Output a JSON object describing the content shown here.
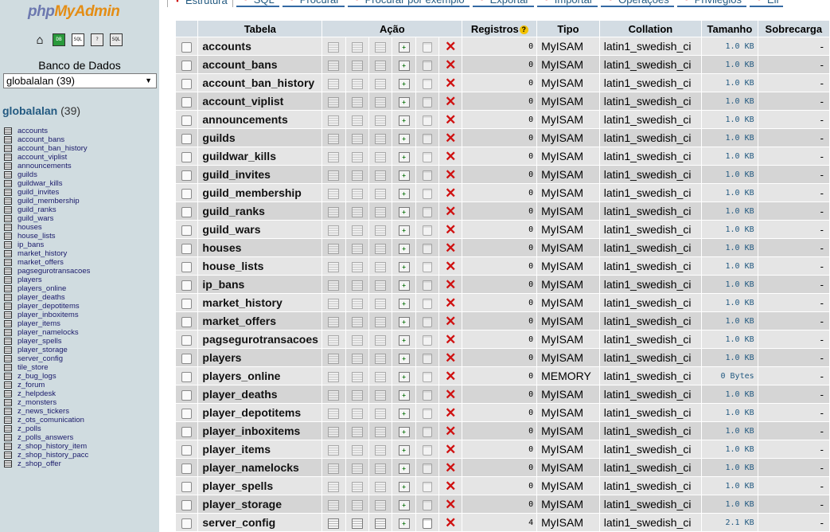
{
  "logo": {
    "part1": "php",
    "part2": "MyAdmin"
  },
  "nav_icons": [
    "home-icon",
    "db-icon",
    "sql-icon",
    "docs-icon",
    "query-icon"
  ],
  "left": {
    "db_label": "Banco de Dados",
    "db_select": "globalalan (39)",
    "db_name": "globalalan",
    "db_count": "(39)",
    "tables": [
      "accounts",
      "account_bans",
      "account_ban_history",
      "account_viplist",
      "announcements",
      "guilds",
      "guildwar_kills",
      "guild_invites",
      "guild_membership",
      "guild_ranks",
      "guild_wars",
      "houses",
      "house_lists",
      "ip_bans",
      "market_history",
      "market_offers",
      "pagsegurotransacoes",
      "players",
      "players_online",
      "player_deaths",
      "player_depotitems",
      "player_inboxitems",
      "player_items",
      "player_namelocks",
      "player_spells",
      "player_storage",
      "server_config",
      "tile_store",
      "z_bug_logs",
      "z_forum",
      "z_helpdesk",
      "z_monsters",
      "z_news_tickers",
      "z_ots_comunication",
      "z_polls",
      "z_polls_answers",
      "z_shop_history_item",
      "z_shop_history_pacc",
      "z_shop_offer"
    ]
  },
  "tabs": [
    "Estrutura",
    "SQL",
    "Procurar",
    "Procurar por exemplo",
    "Exportar",
    "Importar",
    "Operações",
    "Privilégios",
    "Eli"
  ],
  "headers": {
    "tabela": "Tabela",
    "acao": "Ação",
    "registros": "Registros",
    "tipo": "Tipo",
    "collation": "Collation",
    "tamanho": "Tamanho",
    "sobrecarga": "Sobrecarga"
  },
  "rows": [
    {
      "name": "accounts",
      "reg": "0",
      "tipo": "MyISAM",
      "col": "latin1_swedish_ci",
      "tam": "1.0 KB",
      "sob": "-"
    },
    {
      "name": "account_bans",
      "reg": "0",
      "tipo": "MyISAM",
      "col": "latin1_swedish_ci",
      "tam": "1.0 KB",
      "sob": "-"
    },
    {
      "name": "account_ban_history",
      "reg": "0",
      "tipo": "MyISAM",
      "col": "latin1_swedish_ci",
      "tam": "1.0 KB",
      "sob": "-"
    },
    {
      "name": "account_viplist",
      "reg": "0",
      "tipo": "MyISAM",
      "col": "latin1_swedish_ci",
      "tam": "1.0 KB",
      "sob": "-"
    },
    {
      "name": "announcements",
      "reg": "0",
      "tipo": "MyISAM",
      "col": "latin1_swedish_ci",
      "tam": "1.0 KB",
      "sob": "-"
    },
    {
      "name": "guilds",
      "reg": "0",
      "tipo": "MyISAM",
      "col": "latin1_swedish_ci",
      "tam": "1.0 KB",
      "sob": "-"
    },
    {
      "name": "guildwar_kills",
      "reg": "0",
      "tipo": "MyISAM",
      "col": "latin1_swedish_ci",
      "tam": "1.0 KB",
      "sob": "-"
    },
    {
      "name": "guild_invites",
      "reg": "0",
      "tipo": "MyISAM",
      "col": "latin1_swedish_ci",
      "tam": "1.0 KB",
      "sob": "-"
    },
    {
      "name": "guild_membership",
      "reg": "0",
      "tipo": "MyISAM",
      "col": "latin1_swedish_ci",
      "tam": "1.0 KB",
      "sob": "-"
    },
    {
      "name": "guild_ranks",
      "reg": "0",
      "tipo": "MyISAM",
      "col": "latin1_swedish_ci",
      "tam": "1.0 KB",
      "sob": "-"
    },
    {
      "name": "guild_wars",
      "reg": "0",
      "tipo": "MyISAM",
      "col": "latin1_swedish_ci",
      "tam": "1.0 KB",
      "sob": "-"
    },
    {
      "name": "houses",
      "reg": "0",
      "tipo": "MyISAM",
      "col": "latin1_swedish_ci",
      "tam": "1.0 KB",
      "sob": "-"
    },
    {
      "name": "house_lists",
      "reg": "0",
      "tipo": "MyISAM",
      "col": "latin1_swedish_ci",
      "tam": "1.0 KB",
      "sob": "-"
    },
    {
      "name": "ip_bans",
      "reg": "0",
      "tipo": "MyISAM",
      "col": "latin1_swedish_ci",
      "tam": "1.0 KB",
      "sob": "-"
    },
    {
      "name": "market_history",
      "reg": "0",
      "tipo": "MyISAM",
      "col": "latin1_swedish_ci",
      "tam": "1.0 KB",
      "sob": "-"
    },
    {
      "name": "market_offers",
      "reg": "0",
      "tipo": "MyISAM",
      "col": "latin1_swedish_ci",
      "tam": "1.0 KB",
      "sob": "-"
    },
    {
      "name": "pagsegurotransacoes",
      "reg": "0",
      "tipo": "MyISAM",
      "col": "latin1_swedish_ci",
      "tam": "1.0 KB",
      "sob": "-"
    },
    {
      "name": "players",
      "reg": "0",
      "tipo": "MyISAM",
      "col": "latin1_swedish_ci",
      "tam": "1.0 KB",
      "sob": "-"
    },
    {
      "name": "players_online",
      "reg": "0",
      "tipo": "MEMORY",
      "col": "latin1_swedish_ci",
      "tam": "0 Bytes",
      "sob": "-"
    },
    {
      "name": "player_deaths",
      "reg": "0",
      "tipo": "MyISAM",
      "col": "latin1_swedish_ci",
      "tam": "1.0 KB",
      "sob": "-"
    },
    {
      "name": "player_depotitems",
      "reg": "0",
      "tipo": "MyISAM",
      "col": "latin1_swedish_ci",
      "tam": "1.0 KB",
      "sob": "-"
    },
    {
      "name": "player_inboxitems",
      "reg": "0",
      "tipo": "MyISAM",
      "col": "latin1_swedish_ci",
      "tam": "1.0 KB",
      "sob": "-"
    },
    {
      "name": "player_items",
      "reg": "0",
      "tipo": "MyISAM",
      "col": "latin1_swedish_ci",
      "tam": "1.0 KB",
      "sob": "-"
    },
    {
      "name": "player_namelocks",
      "reg": "0",
      "tipo": "MyISAM",
      "col": "latin1_swedish_ci",
      "tam": "1.0 KB",
      "sob": "-"
    },
    {
      "name": "player_spells",
      "reg": "0",
      "tipo": "MyISAM",
      "col": "latin1_swedish_ci",
      "tam": "1.0 KB",
      "sob": "-"
    },
    {
      "name": "player_storage",
      "reg": "0",
      "tipo": "MyISAM",
      "col": "latin1_swedish_ci",
      "tam": "1.0 KB",
      "sob": "-"
    },
    {
      "name": "server_config",
      "reg": "4",
      "tipo": "MyISAM",
      "col": "latin1_swedish_ci",
      "tam": "2.1 KB",
      "sob": "-",
      "active": true
    }
  ]
}
